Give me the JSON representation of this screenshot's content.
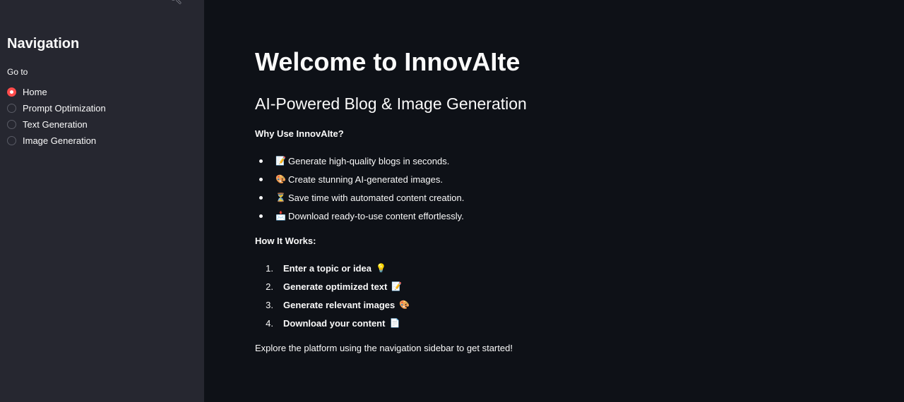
{
  "sidebar": {
    "title": "Navigation",
    "goto_label": "Go to",
    "options": [
      {
        "label": "Home",
        "selected": true
      },
      {
        "label": "Prompt Optimization",
        "selected": false
      },
      {
        "label": "Text Generation",
        "selected": false
      },
      {
        "label": "Image Generation",
        "selected": false
      }
    ]
  },
  "main": {
    "title": "Welcome to InnovAIte",
    "subtitle": "AI-Powered Blog & Image Generation",
    "why_heading": "Why Use InnovAIte?",
    "benefits": [
      {
        "icon": "📝",
        "text": "Generate high-quality blogs in seconds."
      },
      {
        "icon": "🎨",
        "text": "Create stunning AI-generated images."
      },
      {
        "icon": "⏳",
        "text": "Save time with automated content creation."
      },
      {
        "icon": "📩",
        "text": "Download ready-to-use content effortlessly."
      }
    ],
    "how_heading": "How It Works:",
    "steps": [
      {
        "num": "1.",
        "text": "Enter a topic or idea",
        "icon": "💡"
      },
      {
        "num": "2.",
        "text": "Generate optimized text",
        "icon": "📝"
      },
      {
        "num": "3.",
        "text": "Generate relevant images",
        "icon": "🎨"
      },
      {
        "num": "4.",
        "text": "Download your content",
        "icon": "📄"
      }
    ],
    "footer": "Explore the platform using the navigation sidebar to get started!"
  },
  "colors": {
    "background": "#0e1117",
    "sidebar": "#262730",
    "accent": "#ff4b4b",
    "text": "#fafafa"
  }
}
